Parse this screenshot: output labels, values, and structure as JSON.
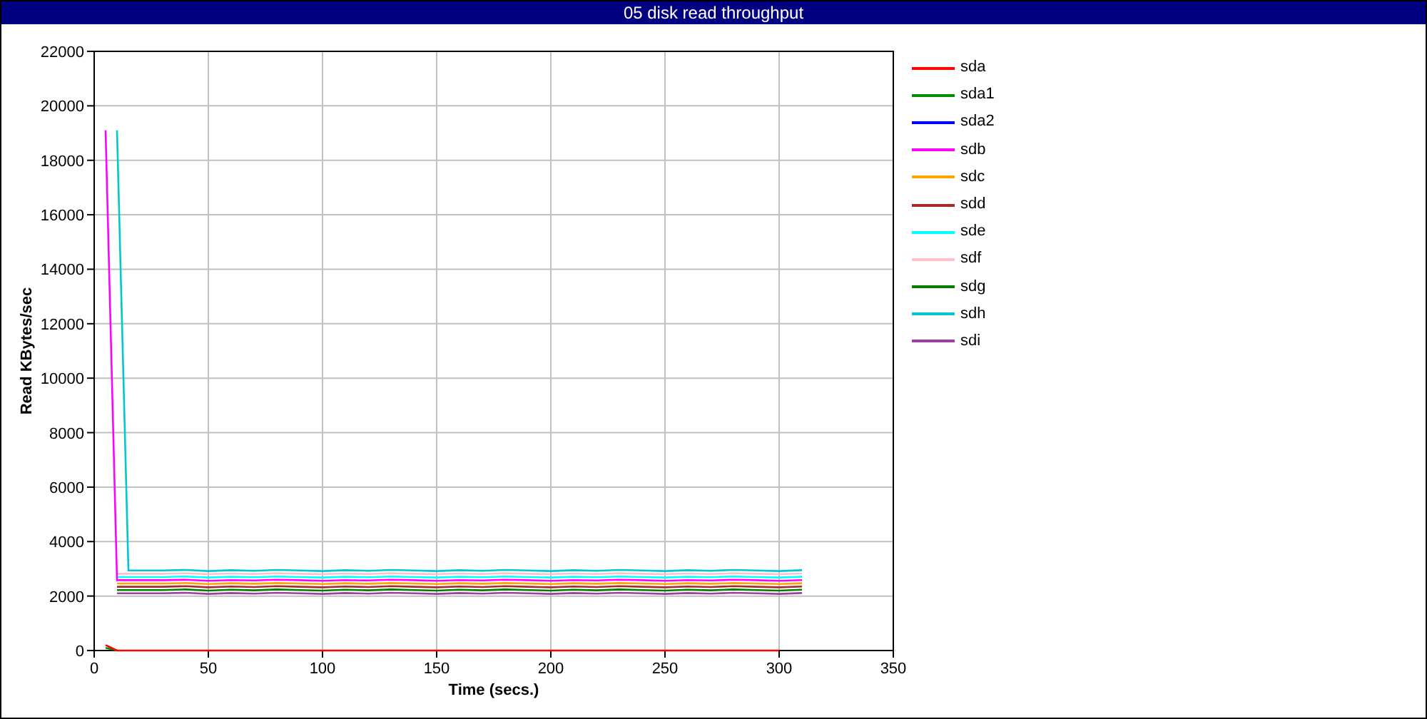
{
  "chart": {
    "chart_data": {
      "type": "line",
      "title": "05 disk read throughput",
      "xlabel": "Time (secs.)",
      "ylabel": "Read KBytes/sec",
      "grid": true,
      "x": [
        5,
        10,
        15,
        20,
        30,
        40,
        50,
        60,
        70,
        80,
        90,
        100,
        110,
        120,
        130,
        140,
        150,
        160,
        170,
        180,
        190,
        200,
        210,
        220,
        230,
        240,
        250,
        260,
        270,
        280,
        290,
        300,
        310
      ],
      "xlim": [
        0,
        350
      ],
      "ylim": [
        0,
        22000
      ],
      "xticks": [
        0,
        50,
        100,
        150,
        200,
        250,
        300,
        350
      ],
      "yticks": [
        0,
        2000,
        4000,
        6000,
        8000,
        10000,
        12000,
        14000,
        16000,
        18000,
        20000,
        22000
      ],
      "series": [
        {
          "name": "sda",
          "color": "#ff0000",
          "values": [
            200,
            0,
            0,
            0,
            0,
            0,
            0,
            0,
            0,
            0,
            0,
            0,
            0,
            0,
            0,
            0,
            0,
            0,
            0,
            0,
            0,
            0,
            0,
            0,
            0,
            0,
            0,
            0,
            0,
            0,
            0,
            0,
            null
          ]
        },
        {
          "name": "sda1",
          "color": "#008f00",
          "values": [
            100,
            0,
            null,
            null,
            null,
            null,
            null,
            null,
            null,
            null,
            null,
            null,
            null,
            null,
            null,
            null,
            null,
            null,
            null,
            null,
            null,
            null,
            null,
            null,
            null,
            null,
            null,
            null,
            null,
            null,
            null,
            null,
            null
          ]
        },
        {
          "name": "sda2",
          "color": "#0000ff",
          "values": [
            null,
            null,
            null,
            null,
            null,
            null,
            null,
            null,
            null,
            null,
            null,
            null,
            null,
            null,
            null,
            null,
            null,
            null,
            null,
            null,
            null,
            null,
            null,
            null,
            null,
            null,
            null,
            null,
            null,
            null,
            null,
            null,
            null
          ]
        },
        {
          "name": "sdb",
          "color": "#ff00ff",
          "values": [
            19100,
            2580,
            2580,
            2580,
            2580,
            2600,
            2560,
            2590,
            2570,
            2600,
            2580,
            2560,
            2590,
            2570,
            2600,
            2580,
            2560,
            2590,
            2570,
            2600,
            2580,
            2560,
            2590,
            2570,
            2600,
            2580,
            2560,
            2590,
            2570,
            2600,
            2580,
            2560,
            2590
          ]
        },
        {
          "name": "sdc",
          "color": "#ffa500",
          "values": [
            null,
            2460,
            2460,
            2460,
            2460,
            2480,
            2440,
            2470,
            2450,
            2480,
            2460,
            2440,
            2470,
            2450,
            2480,
            2460,
            2440,
            2470,
            2450,
            2480,
            2460,
            2440,
            2470,
            2450,
            2480,
            2460,
            2440,
            2470,
            2450,
            2480,
            2460,
            2440,
            2470
          ]
        },
        {
          "name": "sdd",
          "color": "#a52a2a",
          "values": [
            null,
            2340,
            2340,
            2340,
            2340,
            2360,
            2320,
            2350,
            2330,
            2360,
            2340,
            2320,
            2350,
            2330,
            2360,
            2340,
            2320,
            2350,
            2330,
            2360,
            2340,
            2320,
            2350,
            2330,
            2360,
            2340,
            2320,
            2350,
            2330,
            2360,
            2340,
            2320,
            2350
          ]
        },
        {
          "name": "sde",
          "color": "#00ffff",
          "values": [
            null,
            2700,
            2700,
            2700,
            2700,
            2720,
            2680,
            2710,
            2690,
            2720,
            2700,
            2680,
            2710,
            2690,
            2720,
            2700,
            2680,
            2710,
            2690,
            2720,
            2700,
            2680,
            2710,
            2690,
            2720,
            2700,
            2680,
            2710,
            2690,
            2720,
            2700,
            2680,
            2710
          ]
        },
        {
          "name": "sdf",
          "color": "#ffc0cb",
          "values": [
            null,
            2820,
            2820,
            2820,
            2820,
            2840,
            2800,
            2830,
            2810,
            2840,
            2820,
            2800,
            2830,
            2810,
            2840,
            2820,
            2800,
            2830,
            2810,
            2840,
            2820,
            2800,
            2830,
            2810,
            2840,
            2820,
            2800,
            2830,
            2810,
            2840,
            2820,
            2800,
            2830
          ]
        },
        {
          "name": "sdg",
          "color": "#007f00",
          "values": [
            null,
            2220,
            2220,
            2220,
            2220,
            2240,
            2200,
            2230,
            2210,
            2240,
            2220,
            2200,
            2230,
            2210,
            2240,
            2220,
            2200,
            2230,
            2210,
            2240,
            2220,
            2200,
            2230,
            2210,
            2240,
            2220,
            2200,
            2230,
            2210,
            2240,
            2220,
            2200,
            2230
          ]
        },
        {
          "name": "sdh",
          "color": "#00c8d0",
          "values": [
            null,
            19100,
            2940,
            2940,
            2940,
            2960,
            2920,
            2950,
            2930,
            2960,
            2940,
            2920,
            2950,
            2930,
            2960,
            2940,
            2920,
            2950,
            2930,
            2960,
            2940,
            2920,
            2950,
            2930,
            2960,
            2940,
            2920,
            2950,
            2930,
            2960,
            2940,
            2920,
            2950
          ]
        },
        {
          "name": "sdi",
          "color": "#a040a0",
          "values": [
            null,
            2100,
            2100,
            2100,
            2100,
            2120,
            2080,
            2110,
            2090,
            2120,
            2100,
            2080,
            2110,
            2090,
            2120,
            2100,
            2080,
            2110,
            2090,
            2120,
            2100,
            2080,
            2110,
            2090,
            2120,
            2100,
            2080,
            2110,
            2090,
            2120,
            2100,
            2080,
            2110
          ]
        }
      ]
    }
  }
}
